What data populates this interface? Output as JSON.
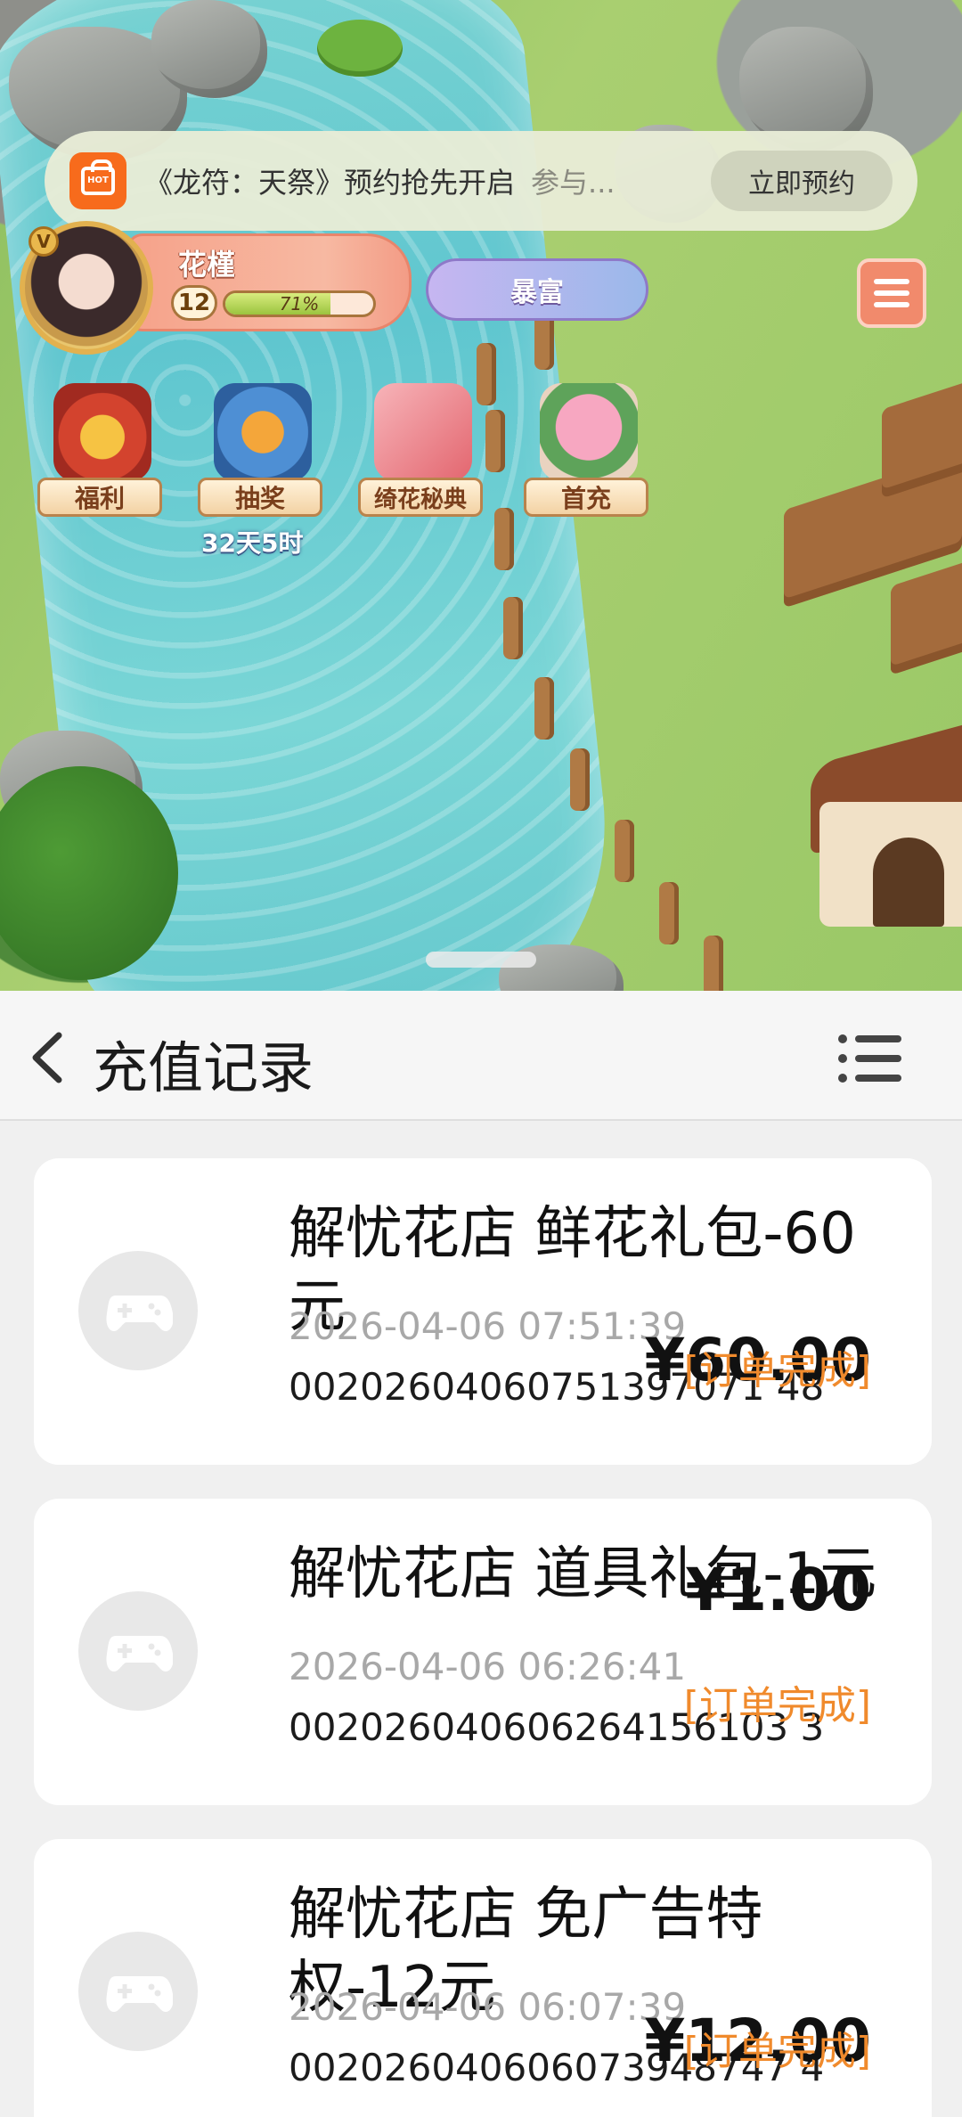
{
  "banner": {
    "badge_text": "HOT",
    "title": "《龙符：天祭》预约抢先开启",
    "subtitle": "参与...",
    "button_label": "立即预约"
  },
  "player": {
    "name": "花槿",
    "vip_badge": "V",
    "level": "12",
    "xp_percent": "71%",
    "xp_fraction": 0.71
  },
  "hud": {
    "jackpot_label": "暴富",
    "features": [
      {
        "label": "福利",
        "icon": "lion-treasure-icon"
      },
      {
        "label": "抽奖",
        "icon": "koi-fish-icon"
      },
      {
        "label": "绮花秘典",
        "icon": "lotus-book-icon"
      },
      {
        "label": "首充",
        "icon": "rose-bouquet-icon"
      }
    ],
    "lottery_countdown": "32天5时"
  },
  "records_page": {
    "title": "充值记录",
    "records": [
      {
        "title": "解忧花店 鲜花礼包-60元",
        "time": "2026-04-06 07:51:39",
        "order_no": "00202604060751397071 48",
        "price": "¥60.00",
        "status": "[订单完成]"
      },
      {
        "title": "解忧花店 道具礼包-1元",
        "time": "2026-04-06 06:26:41",
        "order_no": "002026040606264156103 3",
        "price": "¥1.00",
        "status": "[订单完成]"
      },
      {
        "title": "解忧花店 免广告特权-12元",
        "time": "2026-04-06 06:07:39",
        "order_no": "002026040606073948747 4",
        "price": "¥12.00",
        "status": "[订单完成]"
      }
    ]
  },
  "colors": {
    "accent_orange": "#f08a2c",
    "banner_badge": "#f76b1c",
    "menu_button": "#f18a6c"
  }
}
